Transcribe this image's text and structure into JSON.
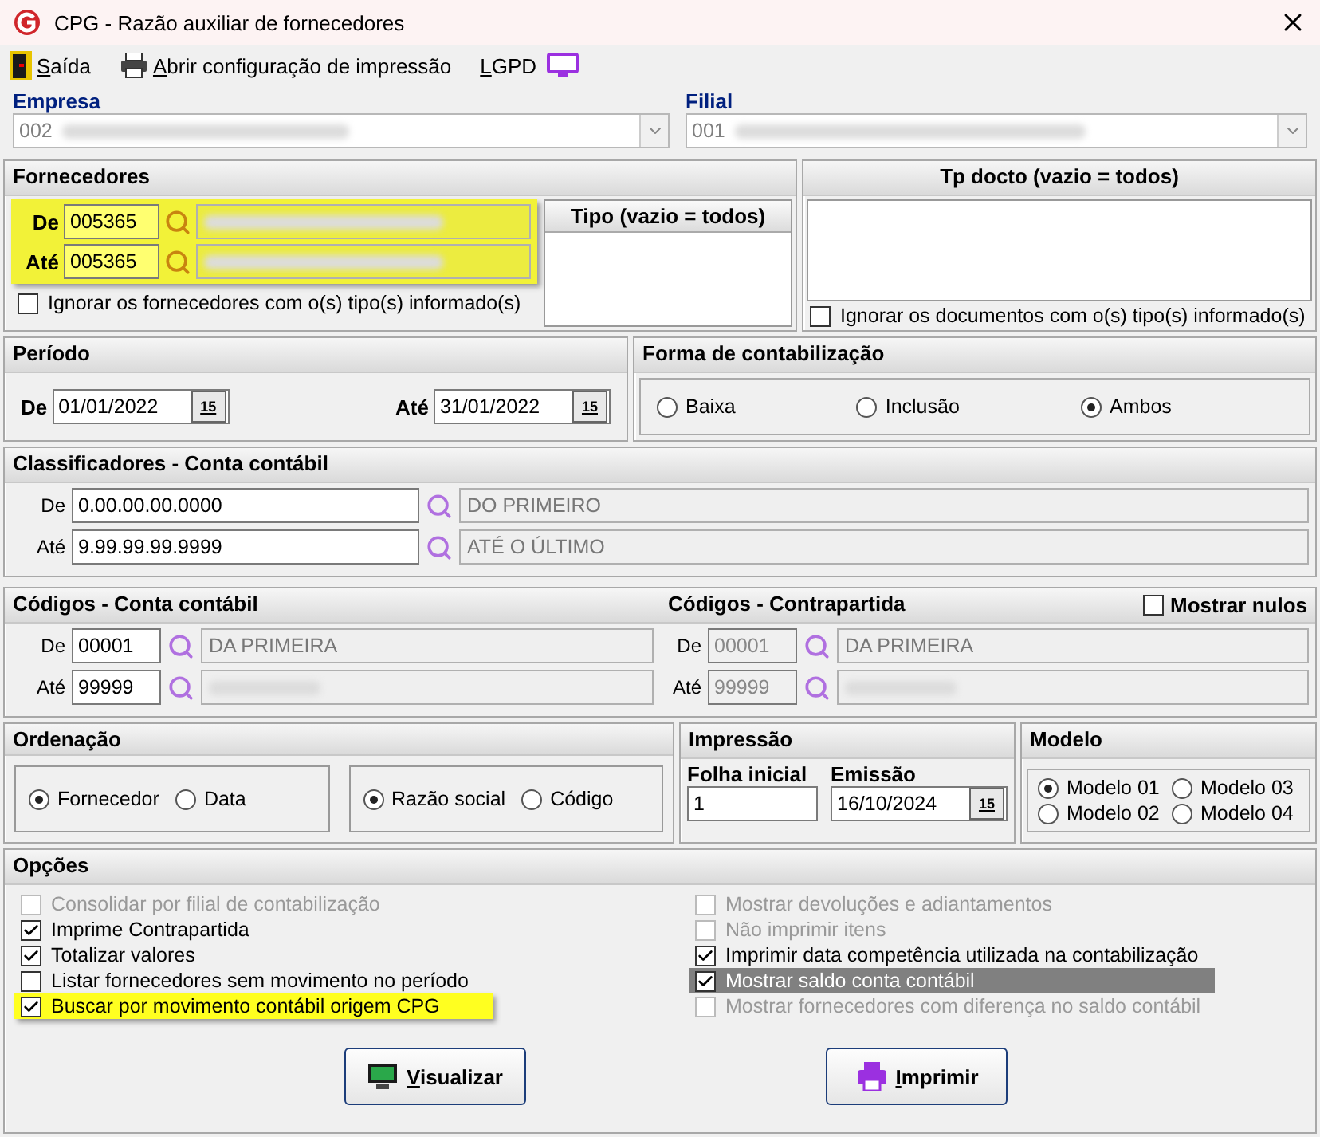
{
  "window": {
    "title": "CPG - Razão auxiliar de fornecedores"
  },
  "toolbar": [
    {
      "label": "Saída",
      "kind": "exit"
    },
    {
      "label": "Abrir configuração de impressão",
      "kind": "print"
    },
    {
      "label": "LGPD",
      "kind": "lgpd"
    }
  ],
  "empresa": {
    "label": "Empresa",
    "code": "002"
  },
  "filial": {
    "label": "Filial",
    "code": "001"
  },
  "fornecedores": {
    "title": "Fornecedores",
    "highlighted": true,
    "rows": [
      {
        "label": "De",
        "value": "005365"
      },
      {
        "label": "Até",
        "value": "005365"
      }
    ],
    "tipo_header": "Tipo (vazio = todos)",
    "ignore": {
      "label": "Ignorar os fornecedores com o(s) tipo(s) informado(s)",
      "checked": false
    }
  },
  "tp_docto": {
    "title": "Tp docto (vazio = todos)",
    "ignore": {
      "label": "Ignorar os documentos com o(s) tipo(s) informado(s)",
      "checked": false
    }
  },
  "periodo": {
    "title": "Período",
    "rows": [
      {
        "label": "De",
        "value": "01/01/2022",
        "calendar": "15"
      },
      {
        "label": "Até",
        "value": "31/01/2022",
        "calendar": "15"
      }
    ]
  },
  "forma": {
    "title": "Forma de contabilização",
    "options": [
      {
        "label": "Baixa",
        "selected": false
      },
      {
        "label": "Inclusão",
        "selected": false
      },
      {
        "label": "Ambos",
        "selected": true
      }
    ]
  },
  "classificadores": {
    "title": "Classificadores - Conta contábil",
    "rows": [
      {
        "label": "De",
        "value": "0.00.00.00.0000",
        "description": "DO PRIMEIRO"
      },
      {
        "label": "Até",
        "value": "9.99.99.99.9999",
        "description": "ATÉ O ÚLTIMO"
      }
    ]
  },
  "codigos_conta": {
    "title": "Códigos - Conta contábil",
    "disabled": false,
    "rows": [
      {
        "label": "De",
        "value": "00001",
        "description": "DA PRIMEIRA"
      },
      {
        "label": "Até",
        "value": "99999"
      }
    ]
  },
  "codigos_contrapartida": {
    "title": "Códigos - Contrapartida",
    "disabled": true,
    "rows": [
      {
        "label": "De",
        "value": "00001",
        "description": "DA PRIMEIRA"
      },
      {
        "label": "Até",
        "value": "99999"
      }
    ]
  },
  "mostrar_nulos": {
    "label": "Mostrar nulos",
    "checked": false
  },
  "ordenacao": {
    "title": "Ordenação",
    "groups": [
      {
        "options": [
          {
            "label": "Fornecedor",
            "selected": true
          },
          {
            "label": "Data",
            "selected": false
          }
        ]
      },
      {
        "options": [
          {
            "label": "Razão social",
            "selected": true
          },
          {
            "label": "Código",
            "selected": false
          }
        ]
      }
    ]
  },
  "impressao": {
    "title": "Impressão",
    "folha": {
      "label": "Folha inicial",
      "value": "1"
    },
    "emissao": {
      "label": "Emissão",
      "value": "16/10/2024",
      "calendar": "15"
    }
  },
  "modelo": {
    "title": "Modelo",
    "options": [
      {
        "label": "Modelo 01",
        "selected": true
      },
      {
        "label": "Modelo 03",
        "selected": false
      },
      {
        "label": "Modelo 02",
        "selected": false
      },
      {
        "label": "Modelo 04",
        "selected": false
      }
    ]
  },
  "opcoes": {
    "title": "Opções",
    "left": [
      {
        "label": "Consolidar por filial de contabilização",
        "checked": false,
        "disabled": true,
        "highlighted": false,
        "focused": false
      },
      {
        "label": "Imprime Contrapartida",
        "checked": true,
        "disabled": false,
        "highlighted": false,
        "focused": false
      },
      {
        "label": "Totalizar valores",
        "checked": true,
        "disabled": false,
        "highlighted": false,
        "focused": false
      },
      {
        "label": "Listar fornecedores sem movimento no período",
        "checked": false,
        "disabled": false,
        "highlighted": false,
        "focused": false
      },
      {
        "label": "Buscar por movimento contábil origem CPG",
        "checked": true,
        "disabled": false,
        "highlighted": true,
        "focused": false
      }
    ],
    "right": [
      {
        "label": "Mostrar devoluções e adiantamentos",
        "checked": false,
        "disabled": true,
        "highlighted": false,
        "focused": false
      },
      {
        "label": "Não imprimir itens",
        "checked": false,
        "disabled": true,
        "highlighted": false,
        "focused": false
      },
      {
        "label": "Imprimir data competência utilizada na contabilização",
        "checked": true,
        "disabled": false,
        "highlighted": false,
        "focused": false
      },
      {
        "label": "Mostrar saldo conta contábil",
        "checked": true,
        "disabled": false,
        "highlighted": false,
        "focused": true
      },
      {
        "label": "Mostrar fornecedores com diferença no saldo contábil",
        "checked": false,
        "disabled": true,
        "highlighted": false,
        "focused": false
      }
    ]
  },
  "buttons": [
    {
      "label": "Visualizar",
      "kind": "preview"
    },
    {
      "label": "Imprimir",
      "kind": "print"
    }
  ]
}
